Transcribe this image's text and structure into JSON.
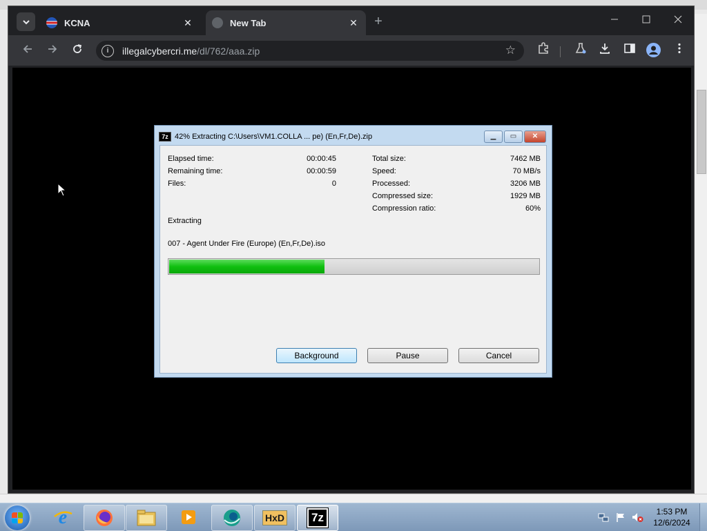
{
  "browser": {
    "tabs": [
      {
        "label": "KCNA",
        "active": false
      },
      {
        "label": "New Tab",
        "active": true
      }
    ],
    "close_glyph": "✕",
    "new_tab_glyph": "+",
    "url_host": "illegalcybercri.me",
    "url_path": "/dl/762/aaa.zip"
  },
  "dialog": {
    "title": "42% Extracting C:\\Users\\VM1.COLLA ... pe) (En,Fr,De).zip",
    "icon_text": "7z",
    "left_stats": [
      {
        "label": "Elapsed time:",
        "value": "00:00:45"
      },
      {
        "label": "Remaining time:",
        "value": "00:00:59"
      },
      {
        "label": "Files:",
        "value": "0"
      }
    ],
    "right_stats": [
      {
        "label": "Total size:",
        "value": "7462 MB"
      },
      {
        "label": "Speed:",
        "value": "70 MB/s"
      },
      {
        "label": "Processed:",
        "value": "3206 MB"
      },
      {
        "label": "Compressed size:",
        "value": "1929 MB"
      },
      {
        "label": "Compression ratio:",
        "value": "60%"
      }
    ],
    "status": "Extracting",
    "filename": "007 - Agent Under Fire (Europe) (En,Fr,De).iso",
    "progress_percent": 42,
    "buttons": {
      "background": "Background",
      "pause": "Pause",
      "cancel": "Cancel"
    }
  },
  "taskbar": {
    "apps": [
      "Internet Explorer",
      "Firefox",
      "Windows Explorer",
      "Media Player",
      "Browser",
      "HxD",
      "7-Zip"
    ],
    "hxd_label": "HxD",
    "sevenzip_label": "7z",
    "clock_time": "1:53 PM",
    "clock_date": "12/6/2024"
  },
  "colors": {
    "progress_fill": "#10c010",
    "page_background": "#000000",
    "tab_strip": "#202124",
    "toolbar": "#35363a"
  }
}
